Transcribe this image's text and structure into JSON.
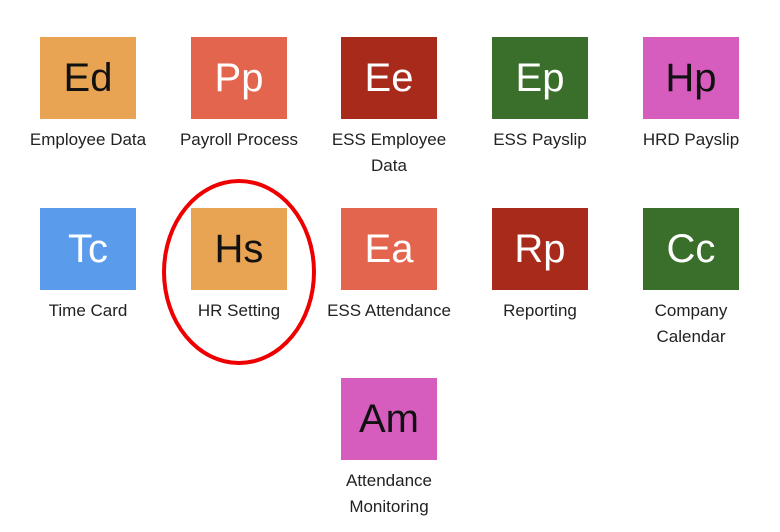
{
  "apps": [
    {
      "abbr": "Ed",
      "label": "Employee Data",
      "color": "#E8A453",
      "text_color": "#111111"
    },
    {
      "abbr": "Pp",
      "label": "Payroll Process",
      "color": "#E4654E",
      "text_color": "#ffffff"
    },
    {
      "abbr": "Ee",
      "label": "ESS Employee Data",
      "color": "#A82A1B",
      "text_color": "#ffffff"
    },
    {
      "abbr": "Ep",
      "label": "ESS Payslip",
      "color": "#3A6F2B",
      "text_color": "#ffffff"
    },
    {
      "abbr": "Hp",
      "label": "HRD Payslip",
      "color": "#D65CBE",
      "text_color": "#111111"
    },
    {
      "abbr": "Tc",
      "label": "Time Card",
      "color": "#5A9CEB",
      "text_color": "#ffffff"
    },
    {
      "abbr": "Hs",
      "label": "HR Setting",
      "color": "#E8A453",
      "text_color": "#111111"
    },
    {
      "abbr": "Ea",
      "label": "ESS Attendance",
      "color": "#E4654E",
      "text_color": "#ffffff"
    },
    {
      "abbr": "Rp",
      "label": "Reporting",
      "color": "#A82A1B",
      "text_color": "#ffffff"
    },
    {
      "abbr": "Cc",
      "label": "Company Calendar",
      "color": "#3A6F2B",
      "text_color": "#ffffff"
    },
    {
      "abbr": "Am",
      "label": "Attendance Monitoring",
      "color": "#D65CBE",
      "text_color": "#111111"
    }
  ],
  "highlight": {
    "target": "HR Setting",
    "color": "#EE0000"
  }
}
